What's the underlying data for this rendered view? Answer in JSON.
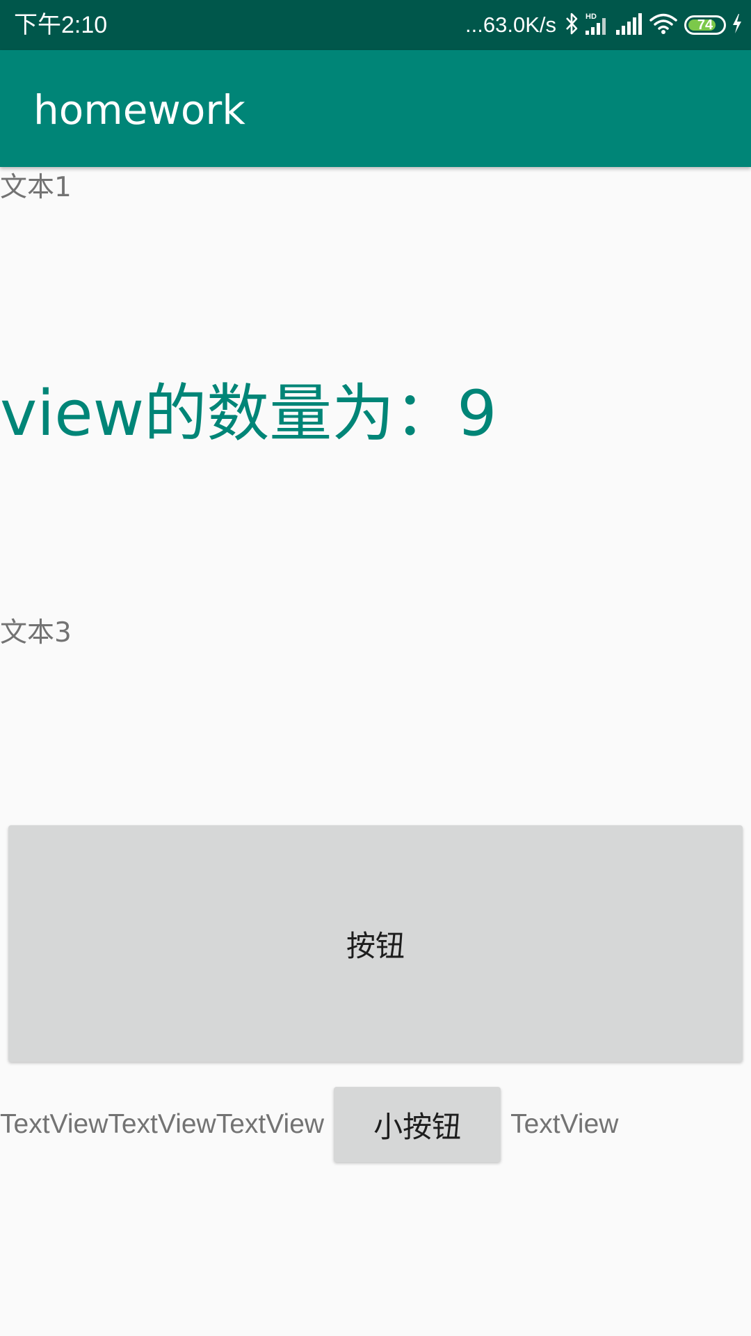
{
  "status_bar": {
    "time": "下午2:10",
    "net_speed": "...63.0K/s",
    "battery_level": "74",
    "icons": [
      "bluetooth-icon",
      "hd-signal-icon",
      "signal-icon",
      "wifi-icon",
      "battery-icon",
      "charging-icon"
    ],
    "colors": {
      "background": "#00574b",
      "battery_fill": "#7cc84a"
    }
  },
  "app_bar": {
    "title": "homework",
    "color": "#008577"
  },
  "content": {
    "text1": "文本1",
    "view_count_text": "view的数量为：9",
    "text3": "文本3",
    "big_button_label": "按钮",
    "row": {
      "text_a": "TextView",
      "text_b": "TextView",
      "text_c": "TextView",
      "small_button_label": "小按钮",
      "text_d": "TextView"
    },
    "accent_color": "#008577"
  }
}
